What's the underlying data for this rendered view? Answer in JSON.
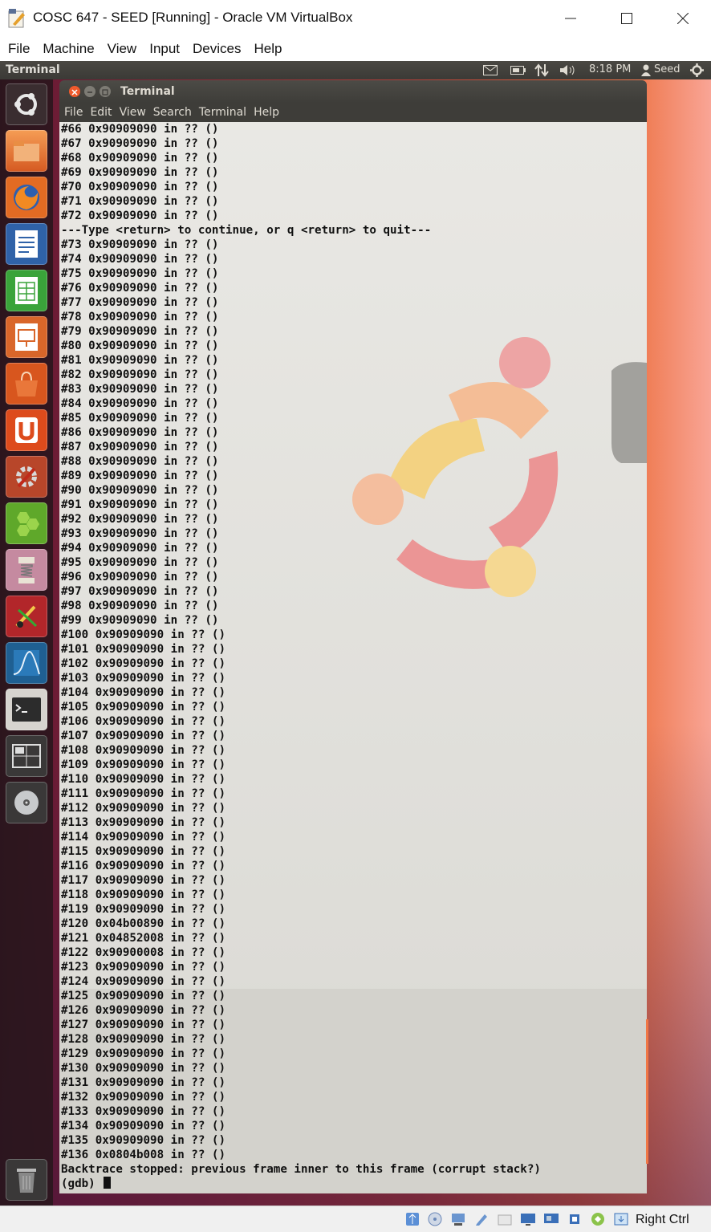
{
  "host": {
    "window_title": "COSC 647 - SEED [Running] - Oracle VM VirtualBox",
    "menu": [
      "File",
      "Machine",
      "View",
      "Input",
      "Devices",
      "Help"
    ],
    "host_key_label": "Right Ctrl"
  },
  "guest": {
    "panel_app_name": "Terminal",
    "clock": "8:18 PM",
    "user": "Seed",
    "launcher_icons": [
      "ubuntu-dash-icon",
      "files-icon",
      "firefox-icon",
      "writer-icon",
      "calc-icon",
      "impress-icon",
      "software-center-icon",
      "ubuntu-one-icon",
      "system-settings-icon",
      "hex-app-icon",
      "archive-app-icon",
      "gedit-app-icon",
      "wireshark-icon",
      "terminal-icon",
      "workspace-switcher-icon",
      "cd-drive-icon",
      "trash-icon"
    ]
  },
  "terminal": {
    "title": "Terminal",
    "menu": [
      "File",
      "Edit",
      "View",
      "Search",
      "Terminal",
      "Help"
    ],
    "lines": [
      "#66 0x90909090 in ?? ()",
      "#67 0x90909090 in ?? ()",
      "#68 0x90909090 in ?? ()",
      "#69 0x90909090 in ?? ()",
      "#70 0x90909090 in ?? ()",
      "#71 0x90909090 in ?? ()",
      "#72 0x90909090 in ?? ()",
      "---Type <return> to continue, or q <return> to quit---",
      "#73 0x90909090 in ?? ()",
      "#74 0x90909090 in ?? ()",
      "#75 0x90909090 in ?? ()",
      "#76 0x90909090 in ?? ()",
      "#77 0x90909090 in ?? ()",
      "#78 0x90909090 in ?? ()",
      "#79 0x90909090 in ?? ()",
      "#80 0x90909090 in ?? ()",
      "#81 0x90909090 in ?? ()",
      "#82 0x90909090 in ?? ()",
      "#83 0x90909090 in ?? ()",
      "#84 0x90909090 in ?? ()",
      "#85 0x90909090 in ?? ()",
      "#86 0x90909090 in ?? ()",
      "#87 0x90909090 in ?? ()",
      "#88 0x90909090 in ?? ()",
      "#89 0x90909090 in ?? ()",
      "#90 0x90909090 in ?? ()",
      "#91 0x90909090 in ?? ()",
      "#92 0x90909090 in ?? ()",
      "#93 0x90909090 in ?? ()",
      "#94 0x90909090 in ?? ()",
      "#95 0x90909090 in ?? ()",
      "#96 0x90909090 in ?? ()",
      "#97 0x90909090 in ?? ()",
      "#98 0x90909090 in ?? ()",
      "#99 0x90909090 in ?? ()",
      "#100 0x90909090 in ?? ()",
      "#101 0x90909090 in ?? ()",
      "#102 0x90909090 in ?? ()",
      "#103 0x90909090 in ?? ()",
      "#104 0x90909090 in ?? ()",
      "#105 0x90909090 in ?? ()",
      "#106 0x90909090 in ?? ()",
      "#107 0x90909090 in ?? ()",
      "#108 0x90909090 in ?? ()",
      "#109 0x90909090 in ?? ()",
      "#110 0x90909090 in ?? ()",
      "#111 0x90909090 in ?? ()",
      "#112 0x90909090 in ?? ()",
      "#113 0x90909090 in ?? ()",
      "#114 0x90909090 in ?? ()",
      "#115 0x90909090 in ?? ()",
      "#116 0x90909090 in ?? ()",
      "#117 0x90909090 in ?? ()",
      "#118 0x90909090 in ?? ()",
      "#119 0x90909090 in ?? ()",
      "#120 0x04b00890 in ?? ()",
      "#121 0x04852008 in ?? ()",
      "#122 0x90900008 in ?? ()",
      "#123 0x90909090 in ?? ()",
      "#124 0x90909090 in ?? ()",
      "#125 0x90909090 in ?? ()",
      "#126 0x90909090 in ?? ()",
      "#127 0x90909090 in ?? ()",
      "#128 0x90909090 in ?? ()",
      "#129 0x90909090 in ?? ()",
      "#130 0x90909090 in ?? ()",
      "#131 0x90909090 in ?? ()",
      "#132 0x90909090 in ?? ()",
      "#133 0x90909090 in ?? ()",
      "#134 0x90909090 in ?? ()",
      "#135 0x90909090 in ?? ()",
      "#136 0x0804b008 in ?? ()",
      "Backtrace stopped: previous frame inner to this frame (corrupt stack?)"
    ],
    "prompt": "(gdb) "
  }
}
